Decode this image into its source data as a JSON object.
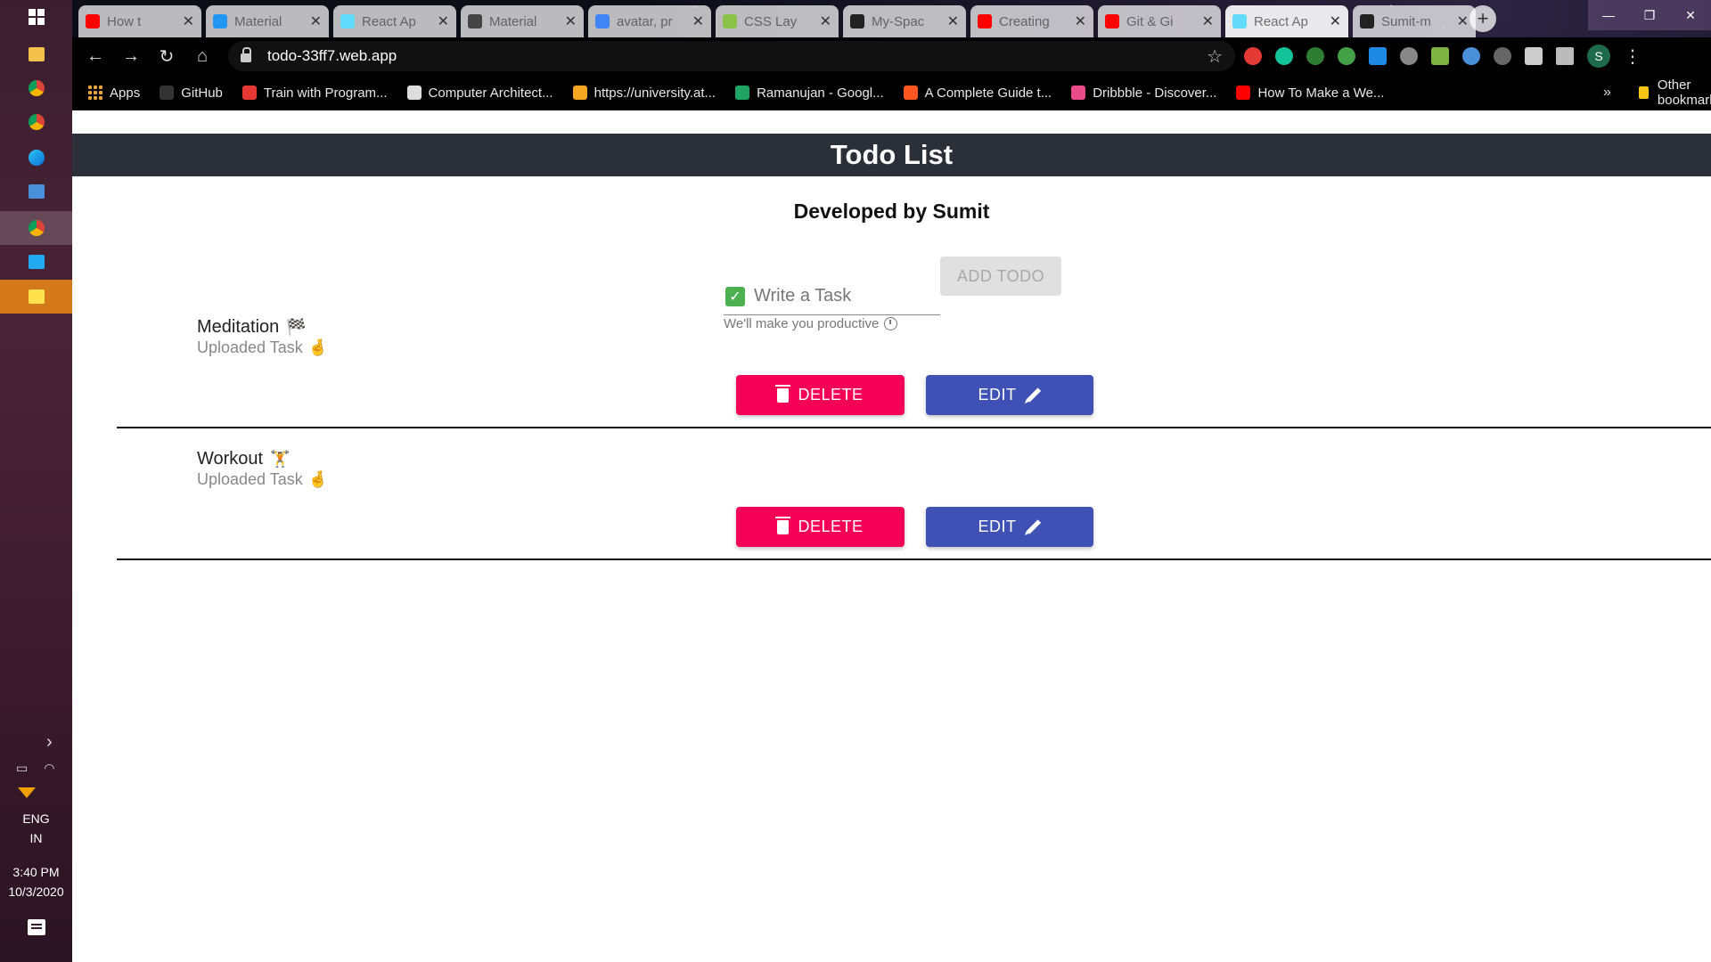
{
  "taskbar": {
    "lang_line1": "ENG",
    "lang_line2": "IN",
    "time": "3:40 PM",
    "date": "10/3/2020"
  },
  "browser": {
    "tabs": [
      {
        "title": "How t",
        "favicon_color": "#ff0000"
      },
      {
        "title": "Material",
        "favicon_color": "#2196f3"
      },
      {
        "title": "React Ap",
        "favicon_color": "#61dafb"
      },
      {
        "title": "Material",
        "favicon_color": "#444444"
      },
      {
        "title": "avatar, pr",
        "favicon_color": "#4285f4"
      },
      {
        "title": "CSS Lay",
        "favicon_color": "#8bc34a"
      },
      {
        "title": "My-Spac",
        "favicon_color": "#222222"
      },
      {
        "title": "Creating",
        "favicon_color": "#ff0000"
      },
      {
        "title": "Git & Gi",
        "favicon_color": "#ff0000"
      },
      {
        "title": "React Ap",
        "favicon_color": "#61dafb",
        "active": true
      },
      {
        "title": "Sumit-m",
        "favicon_color": "#222222"
      }
    ],
    "url": "todo-33ff7.web.app",
    "profile_initial": "S",
    "bookmarks": [
      {
        "label": "Apps",
        "icon": "apps-grid"
      },
      {
        "label": "GitHub",
        "icon": "github-icon",
        "color": "#333333"
      },
      {
        "label": "Train with Program...",
        "icon": "program-icon",
        "color": "#e53935"
      },
      {
        "label": "Computer Architect...",
        "icon": "globe-icon",
        "color": "#dddddd"
      },
      {
        "label": "https://university.at...",
        "icon": "ladder-icon",
        "color": "#f5a623"
      },
      {
        "label": "Ramanujan - Googl...",
        "icon": "drive-icon",
        "color": "#1fa463"
      },
      {
        "label": "A Complete Guide t...",
        "icon": "gear-icon",
        "color": "#ff5722"
      },
      {
        "label": "Dribbble - Discover...",
        "icon": "dribbble-icon",
        "color": "#ea4c89"
      },
      {
        "label": "How To Make a We...",
        "icon": "youtube-icon",
        "color": "#ff0000"
      }
    ],
    "more_bookmarks": "»",
    "other_bookmarks": "Other bookmarks"
  },
  "app": {
    "header_title": "Todo List",
    "subtitle": "Developed by Sumit",
    "input_placeholder": "Write a Task",
    "helper_text": "We'll make you productive",
    "add_button": "ADD TODO",
    "todos": [
      {
        "title": "Meditation",
        "title_emoji": "🏁",
        "subtitle": "Uploaded Task",
        "subtitle_emoji": "🤞",
        "delete_label": "DELETE",
        "edit_label": "EDIT"
      },
      {
        "title": "Workout",
        "title_emoji": "🏋",
        "subtitle": "Uploaded Task",
        "subtitle_emoji": "🤞",
        "delete_label": "DELETE",
        "edit_label": "EDIT"
      }
    ]
  }
}
